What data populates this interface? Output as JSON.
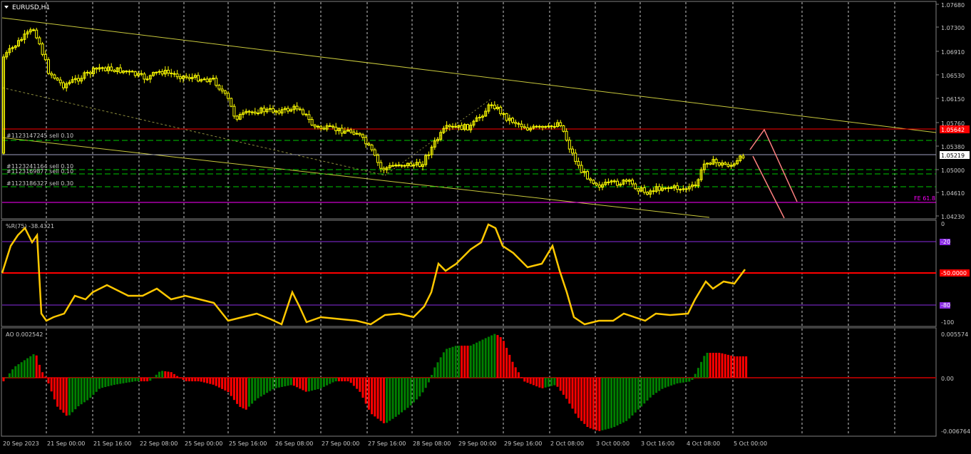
{
  "symbol": "EURUSD,H1",
  "main_panel": {
    "price_ticks": [
      "1.07680",
      "1.07300",
      "1.06910",
      "1.06530",
      "1.06150",
      "1.05760",
      "1.05380",
      "1.05000",
      "1.04610",
      "1.04230"
    ],
    "current_price": "1.05219",
    "level_price": "1.05642",
    "fe_label": "FE 61.8",
    "orders": [
      "#1123147245 sell 0.10",
      "#1123241164 sell 0.10",
      "#1123169877 sell 0.10",
      "#1123186327 sell 0.30"
    ]
  },
  "wpr_panel": {
    "label": "%R(75) -38.4321",
    "levels": [
      "0",
      "-20",
      "-50.0000",
      "-80",
      "-100"
    ]
  },
  "ao_panel": {
    "label": "AO 0.002542",
    "ticks": [
      "0.005574",
      "0.00",
      "-0.006764"
    ]
  },
  "time_labels": [
    "20 Sep 2023",
    "21 Sep 00:00",
    "21 Sep 16:00",
    "22 Sep 08:00",
    "25 Sep 00:00",
    "25 Sep 16:00",
    "26 Sep 08:00",
    "27 Sep 00:00",
    "27 Sep 16:00",
    "28 Sep 08:00",
    "29 Sep 00:00",
    "29 Sep 16:00",
    "2 Oct 08:00",
    "3 Oct 00:00",
    "3 Oct 16:00",
    "4 Oct 08:00",
    "5 Oct 00:00"
  ],
  "colors": {
    "background": "#000000",
    "candles": "#ffff00",
    "channel": "#c8c83c",
    "resistance": "#ff0000",
    "fibo": "#ff00ff",
    "orders": "#00c800",
    "wpr": "#ffc800",
    "ao_up": "#008000",
    "ao_down": "#ff0000",
    "projection": "#ff8080"
  }
}
